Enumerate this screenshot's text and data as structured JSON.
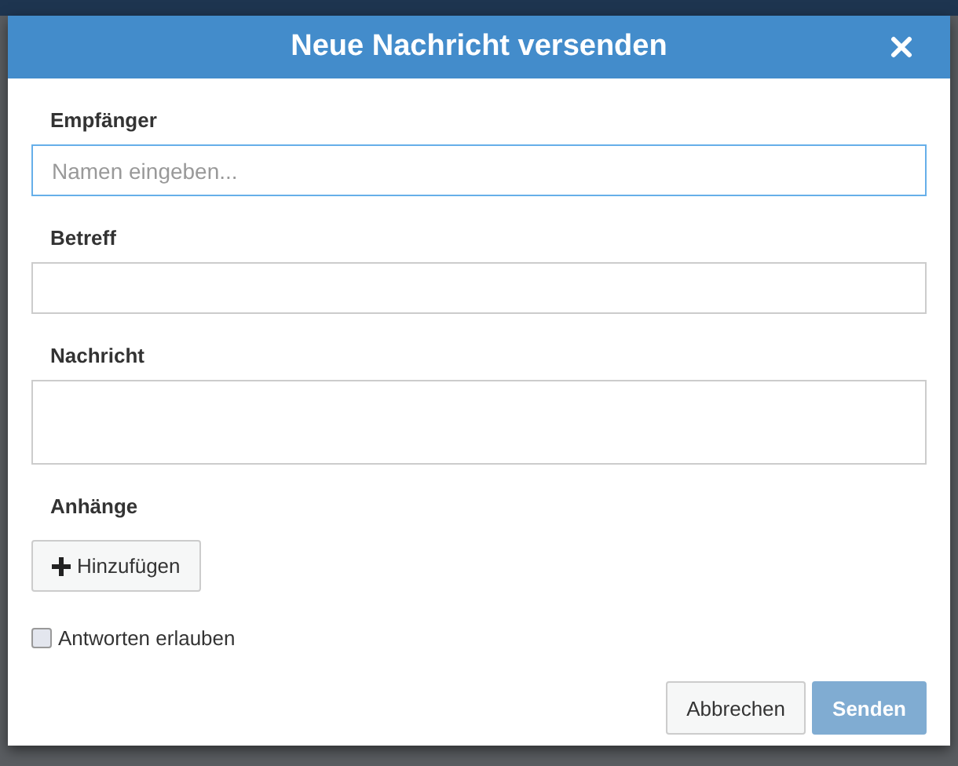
{
  "dialog": {
    "title": "Neue Nachricht versenden"
  },
  "fields": [
    {
      "kind": "input",
      "label": "Empfänger",
      "placeholder": "Namen eingeben...",
      "focused": true
    },
    {
      "kind": "input",
      "label": "Betreff",
      "focused": false
    },
    {
      "kind": "textarea",
      "label": "Nachricht",
      "focused": false
    }
  ],
  "attachments": {
    "label": "Anhänge",
    "add_button": "Hinzufügen"
  },
  "allow_replies": {
    "label": "Antworten erlauben",
    "checked": false
  },
  "buttons": [
    {
      "label": "Abbrechen",
      "kind": "default",
      "disabled": false
    },
    {
      "label": "Senden",
      "kind": "primary",
      "disabled": true
    }
  ]
}
